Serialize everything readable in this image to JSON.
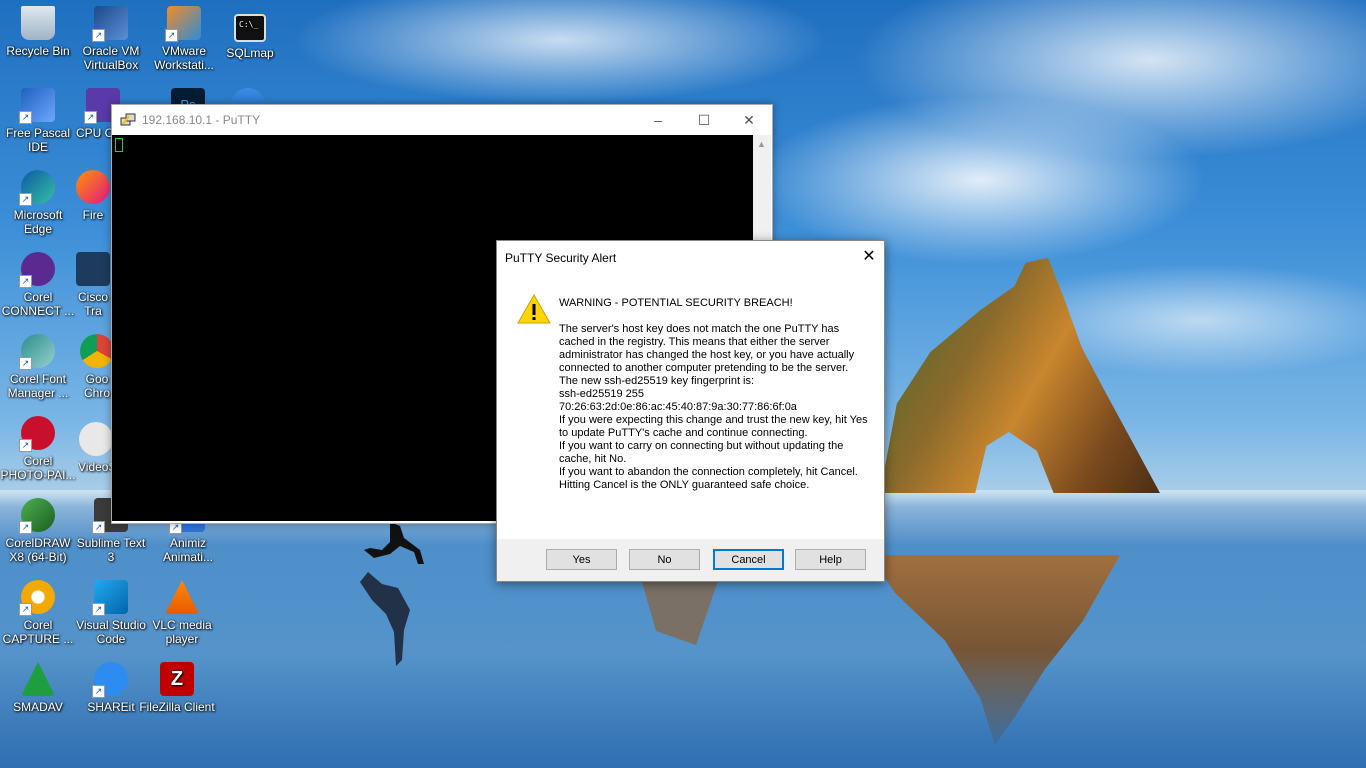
{
  "desktop": {
    "icons": [
      {
        "label": "Recycle Bin",
        "icon": "recycle-bin-icon"
      },
      {
        "label": "Oracle VM VirtualBox",
        "icon": "virtualbox-icon"
      },
      {
        "label": "VMware Workstati...",
        "icon": "vmware-icon"
      },
      {
        "label": "SQLmap",
        "icon": "terminal-icon"
      },
      {
        "label": "Free Pascal IDE",
        "icon": "free-pascal-icon"
      },
      {
        "label": "CPU CPU",
        "icon": "cpu-icon"
      },
      {
        "label": "Microsoft Edge",
        "icon": "edge-icon"
      },
      {
        "label": "Fire",
        "icon": "firefox-icon"
      },
      {
        "label": "Corel CONNECT ...",
        "icon": "corel-connect-icon"
      },
      {
        "label": "Cisco Tra",
        "icon": "cisco-icon"
      },
      {
        "label": "Corel Font Manager ...",
        "icon": "corel-font-icon"
      },
      {
        "label": "Goo Chro",
        "icon": "chrome-icon"
      },
      {
        "label": "Corel PHOTO-PAI...",
        "icon": "corel-photopaint-icon"
      },
      {
        "label": "VideoS",
        "icon": "videos-icon"
      },
      {
        "label": "CorelDRAW X8 (64-Bit)",
        "icon": "coreldraw-icon"
      },
      {
        "label": "Sublime Text 3",
        "icon": "sublime-icon"
      },
      {
        "label": "Animiz Animati...",
        "icon": "animiz-icon"
      },
      {
        "label": "Corel CAPTURE ...",
        "icon": "corel-capture-icon"
      },
      {
        "label": "Visual Studio Code",
        "icon": "vscode-icon"
      },
      {
        "label": "VLC media player",
        "icon": "vlc-icon"
      },
      {
        "label": "SMADAV",
        "icon": "smadav-icon"
      },
      {
        "label": "SHAREit",
        "icon": "shareit-icon"
      },
      {
        "label": "FileZilla Client",
        "icon": "filezilla-icon"
      }
    ]
  },
  "putty": {
    "title": "192.168.10.1 - PuTTY",
    "minimize": "–",
    "maximize": "☐",
    "close": "✕"
  },
  "alert": {
    "title": "PuTTY Security Alert",
    "close": "✕",
    "heading": "WARNING - POTENTIAL SECURITY BREACH!",
    "message": "The server's host key does not match the one PuTTY has cached in the registry. This means that either the server administrator has changed the host key, or you have actually connected to another computer pretending to be the server.\nThe new ssh-ed25519 key fingerprint is:\nssh-ed25519 255\n70:26:63:2d:0e:86:ac:45:40:87:9a:30:77:86:6f:0a\nIf you were expecting this change and trust the new key, hit Yes to update PuTTY's cache and continue connecting.\nIf you want to carry on connecting but without updating the cache, hit No.\nIf you want to abandon the connection completely, hit Cancel. Hitting Cancel is the ONLY guaranteed safe choice.",
    "buttons": {
      "yes": "Yes",
      "no": "No",
      "cancel": "Cancel",
      "help": "Help"
    }
  }
}
